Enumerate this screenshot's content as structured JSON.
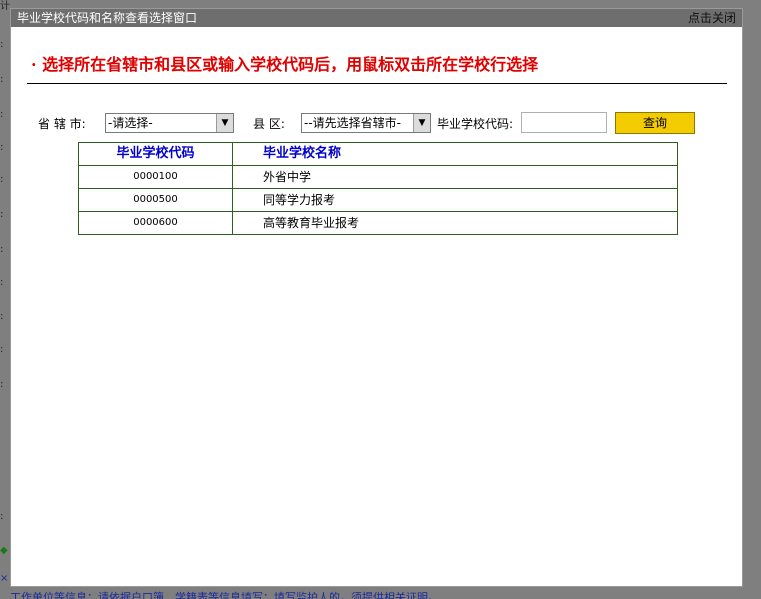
{
  "background": {
    "left_strip_chars": [
      "计",
      ":",
      ":",
      ":",
      ":",
      ":",
      ":",
      ":",
      ":",
      ":",
      ":",
      ":",
      ":",
      "◆",
      "×"
    ],
    "bottom_text": "工作单位等信息：请依据户口簿、学籍表等信息填写；填写监护人的，须提供相关证明。"
  },
  "window": {
    "title": "毕业学校代码和名称查看选择窗口",
    "close_label": "点击关闭"
  },
  "instruction": "· 选择所在省辖市和县区或输入学校代码后，用鼠标双击所在学校行选择",
  "filters": {
    "city_label": "省 辖 市:",
    "city_value": "-请选择-",
    "county_label": "县  区:",
    "county_value": "--请先选择省辖市-",
    "code_label": "毕业学校代码:",
    "code_value": "",
    "query_label": "查询"
  },
  "table": {
    "headers": [
      "毕业学校代码",
      "毕业学校名称"
    ],
    "rows": [
      {
        "code": "0000100",
        "name": "外省中学"
      },
      {
        "code": "0000500",
        "name": "同等学力报考"
      },
      {
        "code": "0000600",
        "name": "高等教育毕业报考"
      }
    ]
  },
  "colors": {
    "titlebar_bg": "#6e6e6e",
    "instruction": "#e00000",
    "header_text": "#0000cc",
    "table_border": "#2f5f1f",
    "button_bg": "#f2cc00"
  }
}
